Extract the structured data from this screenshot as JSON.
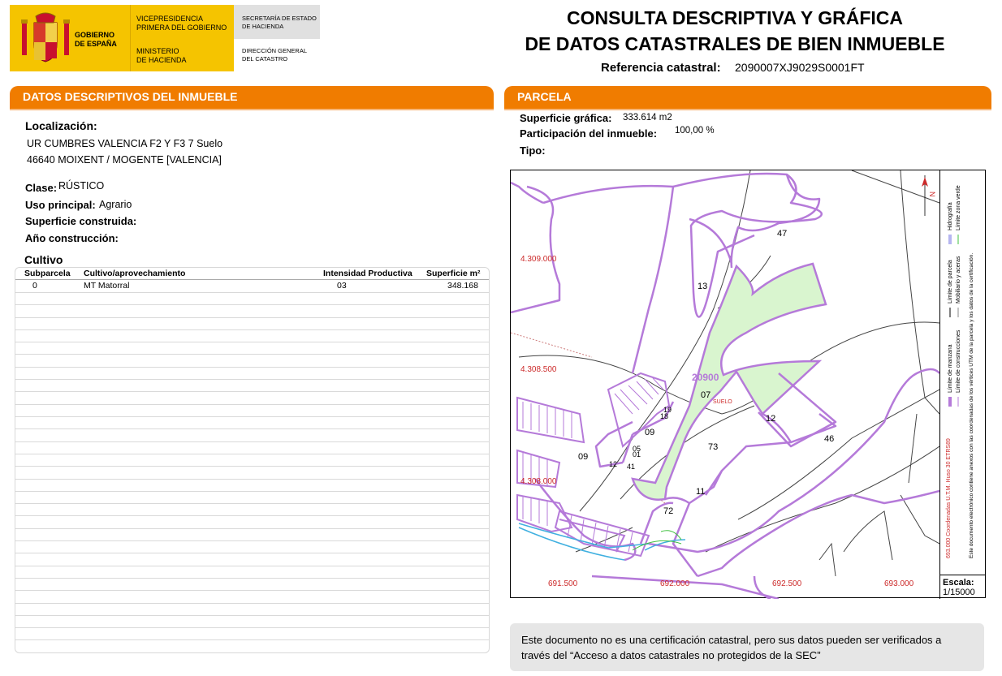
{
  "header": {
    "gov_lines": [
      "GOBIERNO",
      "DE ESPAÑA"
    ],
    "vice_lines": [
      "VICEPRESIDENCIA",
      "PRIMERA DEL GOBIERNO"
    ],
    "mini_lines": [
      "MINISTERIO",
      "DE HACIENDA"
    ],
    "sec_lines": [
      "SECRETARÍA DE ESTADO",
      "DE HACIENDA"
    ],
    "dir_lines": [
      "DIRECCIÓN GENERAL",
      "DEL CATASTRO"
    ],
    "title_line1": "CONSULTA DESCRIPTIVA Y GRÁFICA",
    "title_line2": "DE DATOS CATASTRALES DE BIEN INMUEBLE",
    "ref_label": "Referencia catastral:",
    "ref_value": "2090007XJ9029S0001FT"
  },
  "left": {
    "section_title": "DATOS DESCRIPTIVOS DEL INMUEBLE",
    "localizacion_label": "Localización:",
    "address_line1": "UR CUMBRES VALENCIA F2 Y F3 7 Suelo",
    "address_line2": "46640 MOIXENT / MOGENTE [VALENCIA]",
    "clase_label": "Clase:",
    "clase_value": "RÚSTICO",
    "uso_label": "Uso principal:",
    "uso_value": "Agrario",
    "superficie_label": "Superficie construida:",
    "anio_label": "Año construcción:",
    "cultivo_title": "Cultivo",
    "table": {
      "headers": [
        "Subparcela",
        "Cultivo/aprovechamiento",
        "Intensidad Productiva",
        "Superficie m²"
      ],
      "rows": [
        [
          "0",
          "MT Matorral",
          "03",
          "348.168"
        ]
      ]
    }
  },
  "right": {
    "section_title": "PARCELA",
    "sup_label": "Superficie gráfica:",
    "sup_value": "333.614 m2",
    "part_label": "Participación del inmueble:",
    "part_value": "100,00 %",
    "tipo_label": "Tipo:",
    "map": {
      "y_coords": [
        "4.309.000",
        "4.308.500",
        "4.308.000"
      ],
      "x_coords": [
        "691.500",
        "692.000",
        "692.500",
        "693.000"
      ],
      "parcel_main": "20900",
      "parcel_sub": "07",
      "suelo": "SUELO",
      "labels": [
        "47",
        "13",
        "12",
        "46",
        "73",
        "11",
        "72",
        "09",
        "09",
        "19",
        "18",
        "12",
        "41",
        "05",
        "01"
      ],
      "north": "N",
      "legend_items": [
        "Límite de manzana",
        "Límite de parcela",
        "Límite de construcciones",
        "Mobiliario y aceras",
        "Hidrografía",
        "Límite zona verde"
      ],
      "legend_coord": "693.000 Coordenadas U.T.M. Huso 30 ETRS89",
      "legend_note": "Este documento electrónico contiene anexos con las coordenadas de los vértices UTM de la parcela y los datos de la certificación.",
      "scale_label": "Escala:",
      "scale_value": "1/15000"
    },
    "note_line1": "Este documento no es una certificación catastral, pero sus datos pueden ser verificados a",
    "note_line2": "través del “Acceso a datos catastrales no protegidos de la SEC”"
  },
  "colors": {
    "orange": "#f07c00",
    "gold": "#f5c400",
    "parcel_fill": "#d9f5cf",
    "boundary": "#b57ad9",
    "coord_red": "#cc2a2a"
  }
}
